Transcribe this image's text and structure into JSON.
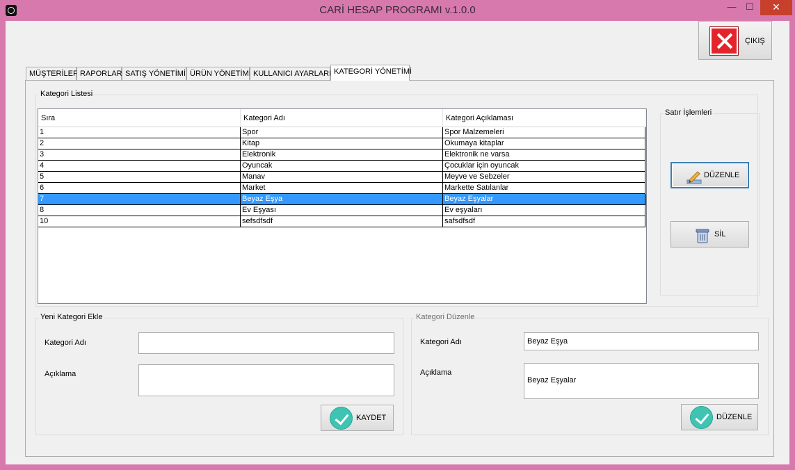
{
  "window": {
    "title": "CARİ HESAP PROGRAMI v.1.0.0",
    "minimize_glyph": "—",
    "maximize_glyph": "☐",
    "close_glyph": "✕"
  },
  "exit_button": {
    "label": "ÇIKIŞ",
    "icon": "close-icon"
  },
  "tabs": [
    {
      "label": "MÜŞTERİLER",
      "active": false
    },
    {
      "label": "RAPORLAR",
      "active": false
    },
    {
      "label": "SATIŞ YÖNETİMİ",
      "active": false
    },
    {
      "label": "ÜRÜN YÖNETİMİ",
      "active": false
    },
    {
      "label": "KULLANICI AYARLARI",
      "active": false
    },
    {
      "label": "KATEGORİ YÖNETİMİ",
      "active": true
    }
  ],
  "category_list": {
    "title": "Kategori Listesi",
    "columns": [
      "Sıra",
      "Kategori Adı",
      "Kategori Açıklaması"
    ],
    "rows": [
      [
        "1",
        "Spor",
        "Spor Malzemeleri"
      ],
      [
        "2",
        "Kitap",
        "Okumaya kitaplar"
      ],
      [
        "3",
        "Elektronik",
        "Elektronik ne varsa"
      ],
      [
        "4",
        "Oyuncak",
        "Çocuklar için oyuncak"
      ],
      [
        "5",
        "Manav",
        "Meyve ve Sebzeler"
      ],
      [
        "6",
        "Market",
        "Markette Satılanlar"
      ],
      [
        "7",
        "Beyaz Eşya",
        "Beyaz Eşyalar"
      ],
      [
        "8",
        "Ev Eşyası",
        "Ev eşyaları"
      ],
      [
        "10",
        "sefsdfsdf",
        "safsdfsdf"
      ]
    ],
    "selected_row": 6
  },
  "row_ops": {
    "title": "Satır İşlemleri",
    "edit_label": "DÜZENLE",
    "delete_label": "SİL"
  },
  "new_category": {
    "title": "Yeni Kategori Ekle",
    "name_label": "Kategori Adı",
    "name_value": "",
    "desc_label": "Açıklama",
    "desc_value": "",
    "save_label": "KAYDET"
  },
  "edit_category": {
    "title": "Kategori Düzenle",
    "name_label": "Kategori Adı",
    "name_value": "Beyaz Eşya",
    "desc_label": "Açıklama",
    "desc_value": "Beyaz Eşyalar",
    "edit_label": "DÜZENLE"
  },
  "colors": {
    "window_frame": "#d779ad",
    "selection": "#3399ff",
    "close_button": "#c7402c",
    "exit_icon": "#e3242b",
    "check_icon": "#3fc4b4"
  }
}
